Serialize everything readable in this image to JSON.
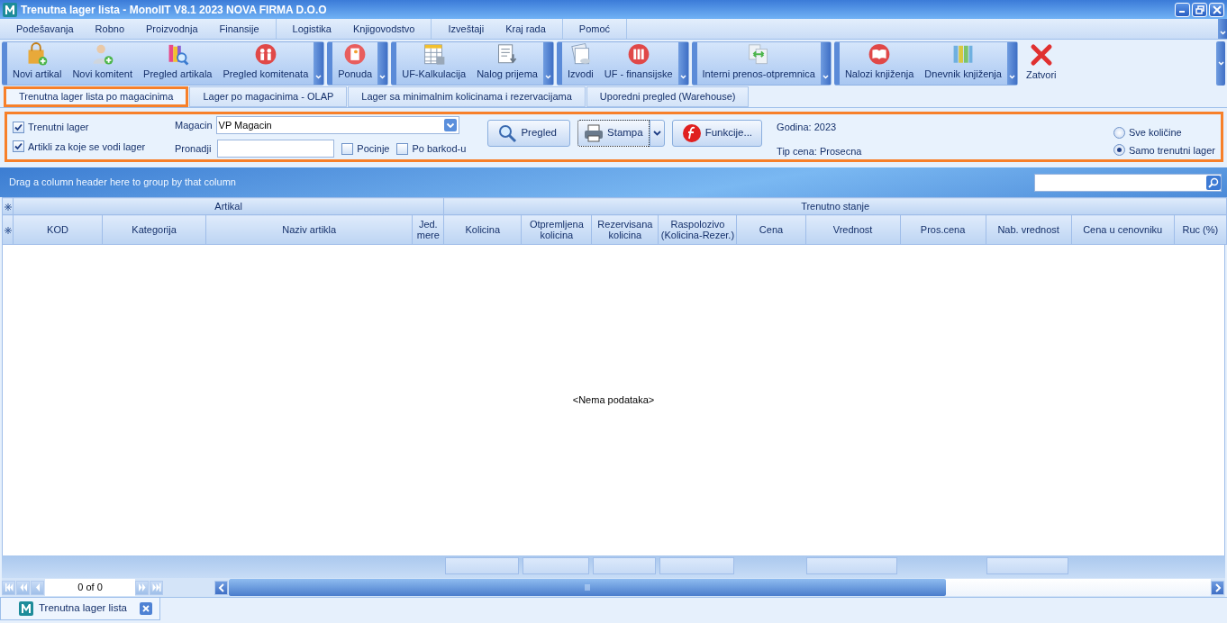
{
  "window": {
    "title": "Trenutna lager lista - MonolIT V8.1 2023 NOVA FIRMA D.O.O"
  },
  "menu": [
    {
      "items": [
        "Podešavanja",
        "Robno",
        "Proizvodnja",
        "Finansije"
      ]
    },
    {
      "items": [
        "Logistika",
        "Knjigovodstvo"
      ]
    },
    {
      "items": [
        "Izveštaji",
        "Kraj rada"
      ]
    },
    {
      "items": [
        "Pomoć"
      ]
    }
  ],
  "toolbar": [
    {
      "dropdown": true,
      "buttons": [
        {
          "label": "Novi artikal",
          "kind": "bag"
        },
        {
          "label": "Novi komitent",
          "kind": "user-add"
        },
        {
          "label": "Pregled artikala",
          "kind": "books"
        },
        {
          "label": "Pregled komitenata",
          "kind": "people-badge"
        }
      ]
    },
    {
      "dropdown": true,
      "buttons": [
        {
          "label": "Ponuda",
          "kind": "note-badge"
        }
      ]
    },
    {
      "dropdown": true,
      "buttons": [
        {
          "label": "UF-Kalkulacija",
          "kind": "spreadsheet"
        },
        {
          "label": "Nalog prijema",
          "kind": "doc-arrow"
        }
      ]
    },
    {
      "dropdown": true,
      "buttons": [
        {
          "label": "Izvodi",
          "kind": "papers"
        },
        {
          "label": "UF - finansijske",
          "kind": "binders-badge"
        }
      ]
    },
    {
      "dropdown": true,
      "buttons": [
        {
          "label": "Interni prenos-otpremnica",
          "kind": "transfer"
        }
      ]
    },
    {
      "dropdown": true,
      "buttons": [
        {
          "label": "Nalozi knjiženja",
          "kind": "book-badge"
        },
        {
          "label": "Dnevnik knjiženja",
          "kind": "binders"
        }
      ]
    },
    {
      "dropdown": false,
      "buttons": [
        {
          "label": "Zatvori",
          "kind": "close"
        }
      ]
    }
  ],
  "tabs": [
    {
      "label": "Trenutna lager lista po magacinima",
      "selected": true
    },
    {
      "label": "Lager po magacinima - OLAP",
      "selected": false
    },
    {
      "label": "Lager sa minimalnim kolicinama i rezervacijama",
      "selected": false
    },
    {
      "label": "Uporedni pregled  (Warehouse)",
      "selected": false
    }
  ],
  "filters": {
    "options": [
      {
        "label": "Trenutni lager",
        "checked": true
      },
      {
        "label": "Artikli za koje se vodi lager",
        "checked": true
      }
    ],
    "magacin": {
      "label": "Magacin",
      "value": "VP Magacin"
    },
    "pronadji": {
      "label": "Pronadji"
    },
    "search_options": [
      {
        "label": "Pocinje",
        "checked": false
      },
      {
        "label": "Po barkod-u",
        "checked": false
      }
    ],
    "buttons": [
      {
        "label": "Pregled",
        "kind": "search"
      },
      {
        "label": "Stampa",
        "kind": "print"
      },
      {
        "label": "Funkcije...",
        "kind": "function"
      }
    ],
    "info": [
      "Godina: 2023",
      "Tip cena: Prosecna"
    ],
    "quantity": [
      {
        "label": "Sve količine",
        "selected": false
      },
      {
        "label": "Samo trenutni lager",
        "selected": true
      }
    ]
  },
  "grid": {
    "group_hint": "Drag a column header here to group by that column",
    "column_groups": [
      {
        "label": "Artikal",
        "columns": [
          {
            "label": "KOD",
            "summary": false
          },
          {
            "label": "Kategorija",
            "summary": false
          },
          {
            "label": "Naziv artikla",
            "summary": false
          },
          {
            "label": "Jed. mere",
            "summary": false
          }
        ]
      },
      {
        "label": "Trenutno stanje",
        "columns": [
          {
            "label": "Kolicina",
            "summary": true
          },
          {
            "label": "Otpremljena kolicina",
            "summary": true
          },
          {
            "label": "Rezervisana kolicina",
            "summary": true
          },
          {
            "label": "Raspolozivo (Kolicina-Rezer.)",
            "summary": true
          },
          {
            "label": "Cena",
            "summary": false
          },
          {
            "label": "Vrednost",
            "summary": true
          },
          {
            "label": "Pros.cena",
            "summary": false
          },
          {
            "label": "Nab. vrednost",
            "summary": true
          },
          {
            "label": "Cena u cenovniku",
            "summary": false
          },
          {
            "label": "Ruc (%)",
            "summary": false
          }
        ]
      }
    ],
    "empty_text": "<Nema podataka>",
    "pager": "0 of 0"
  },
  "document_tabs": [
    {
      "label": "Trenutna lager lista"
    }
  ]
}
